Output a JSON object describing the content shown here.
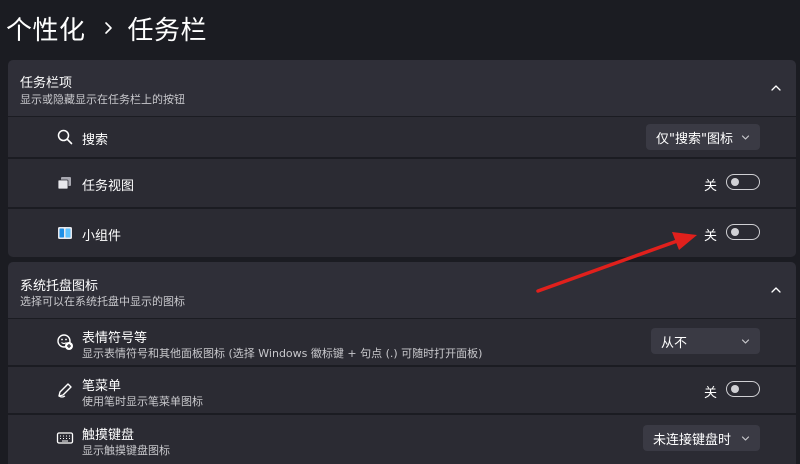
{
  "breadcrumb": {
    "parent": "个性化",
    "current": "任务栏"
  },
  "taskbar_items": {
    "title": "任务栏项",
    "subtitle": "显示或隐藏显示在任务栏上的按钮",
    "rows": [
      {
        "label": "搜索",
        "icon": "search-icon",
        "control": "dropdown",
        "value": "仅\"搜索\"图标"
      },
      {
        "label": "任务视图",
        "icon": "task-view-icon",
        "control": "toggle",
        "state_label": "关",
        "on": false
      },
      {
        "label": "小组件",
        "icon": "widgets-icon",
        "control": "toggle",
        "state_label": "关",
        "on": false
      }
    ]
  },
  "tray_icons": {
    "title": "系统托盘图标",
    "subtitle": "选择可以在系统托盘中显示的图标",
    "rows": [
      {
        "label": "表情符号等",
        "sub": "显示表情符号和其他面板图标 (选择 Windows 徽标键 + 句点 (.) 可随时打开面板)",
        "icon": "emoji-icon",
        "control": "dropdown",
        "value": "从不"
      },
      {
        "label": "笔菜单",
        "sub": "使用笔时显示笔菜单图标",
        "icon": "pen-icon",
        "control": "toggle",
        "state_label": "关",
        "on": false
      },
      {
        "label": "触摸键盘",
        "sub": "显示触摸键盘图标",
        "icon": "keyboard-icon",
        "control": "dropdown",
        "value": "未连接键盘时"
      }
    ]
  },
  "colors": {
    "background": "#1b1c22",
    "card": "#2b2b33",
    "arrow": "#e0201c"
  }
}
